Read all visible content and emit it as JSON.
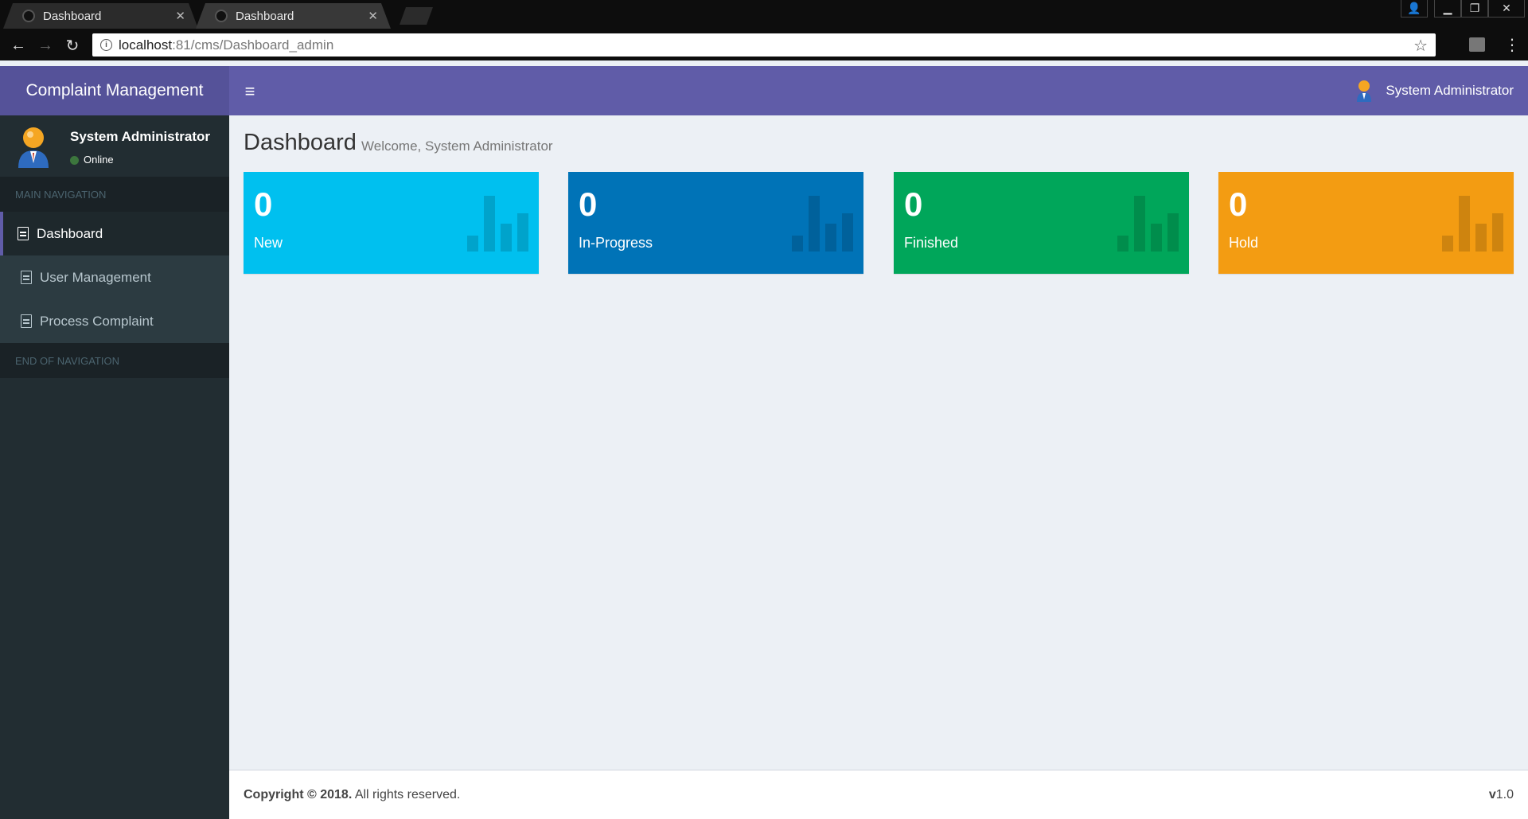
{
  "browser": {
    "tabs": [
      {
        "title": "Dashboard",
        "active": false
      },
      {
        "title": "Dashboard",
        "active": true
      }
    ],
    "url_host": "localhost",
    "url_path": ":81/cms/Dashboard_admin"
  },
  "header": {
    "brand": "Complaint Management",
    "user_name": "System Administrator"
  },
  "sidebar": {
    "user_name": "System Administrator",
    "status": "Online",
    "nav_header": "MAIN NAVIGATION",
    "items": [
      {
        "label": "Dashboard",
        "active": true
      },
      {
        "label": "User Management",
        "active": false
      },
      {
        "label": "Process Complaint",
        "active": false
      }
    ],
    "end_header": "END OF NAVIGATION"
  },
  "page": {
    "title": "Dashboard",
    "subtitle": "Welcome, System Administrator"
  },
  "stats": [
    {
      "count": "0",
      "label": "New",
      "color": "#00c0ef"
    },
    {
      "count": "0",
      "label": "In-Progress",
      "color": "#0073b7"
    },
    {
      "count": "0",
      "label": "Finished",
      "color": "#00a65a"
    },
    {
      "count": "0",
      "label": "Hold",
      "color": "#f39c12"
    }
  ],
  "footer": {
    "copyright": "Copyright © 2018.",
    "rights": " All rights reserved.",
    "version_prefix": "v",
    "version": "1.0"
  }
}
